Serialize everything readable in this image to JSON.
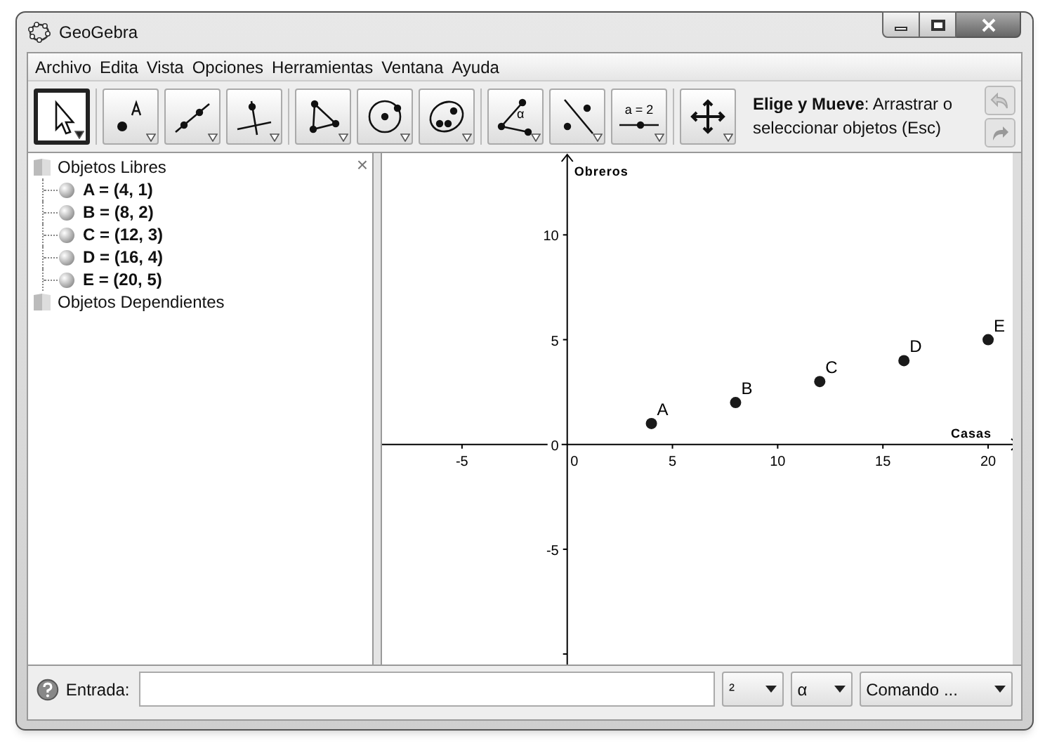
{
  "window": {
    "title": "GeoGebra"
  },
  "menu": [
    "Archivo",
    "Edita",
    "Vista",
    "Opciones",
    "Herramientas",
    "Ventana",
    "Ayuda"
  ],
  "toolbar": {
    "groups": [
      [
        {
          "selected": true
        }
      ],
      [
        {
          "selected": false
        },
        {
          "selected": false
        },
        {
          "selected": false
        }
      ],
      [
        {
          "selected": false
        },
        {
          "selected": false
        },
        {
          "selected": false
        }
      ],
      [
        {
          "selected": false,
          "label": "α"
        },
        {
          "selected": false
        },
        {
          "selected": false,
          "label": "a = 2"
        }
      ],
      [
        {
          "selected": false
        }
      ]
    ],
    "help": "**Elige y Mueve**: Arrastrar o seleccionar objetos (Esc)"
  },
  "algebra": {
    "close": "×",
    "tree": [
      {
        "label": "Objetos Libres",
        "children": [
          {
            "label": "A = (4, 1)"
          },
          {
            "label": "B = (8, 2)"
          },
          {
            "label": "C = (12, 3)"
          },
          {
            "label": "D = (16, 4)"
          },
          {
            "label": "E = (20, 5)"
          }
        ]
      },
      {
        "label": "Objetos Dependientes"
      }
    ]
  },
  "graphics": {
    "chart_data": {
      "type": "scatter",
      "xlabel": "Casas",
      "ylabel": "Obreros",
      "x": [
        4,
        8,
        12,
        16,
        20
      ],
      "series": [
        {
          "color": "#1a1a1a",
          "values": [
            1,
            2,
            3,
            4,
            5
          ]
        }
      ],
      "xlim": [
        -8.8,
        21.5
      ],
      "ylim": [
        -10.5,
        13.9
      ],
      "xticks": [
        -5,
        0,
        5,
        10,
        15,
        20
      ],
      "yticks": [
        -5,
        0,
        5,
        10
      ],
      "annotations": [
        {
          "x": 4,
          "y": 1,
          "text": "A"
        },
        {
          "x": 8,
          "y": 2,
          "text": "B"
        },
        {
          "x": 12,
          "y": 3,
          "text": "C"
        },
        {
          "x": 16,
          "y": 4,
          "text": "D"
        },
        {
          "x": 20,
          "y": 5,
          "text": "E"
        }
      ]
    }
  },
  "input": {
    "label": "Entrada:",
    "dropdowns": [
      "²",
      "α",
      "Comando ..."
    ]
  }
}
